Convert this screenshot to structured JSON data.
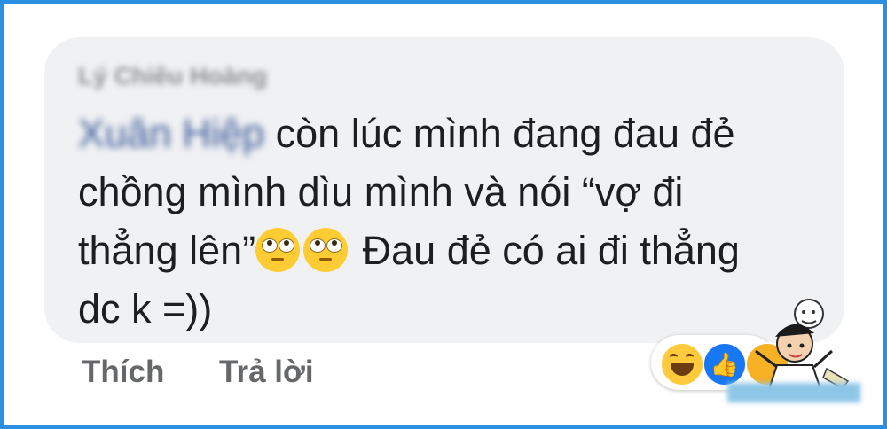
{
  "comment": {
    "author": "Lý Chiêu Hoàng",
    "mention": "Xuân Hiệp",
    "lines": [
      " còn lúc mình đang đau đẻ",
      "chồng mình dìu mình và nói “vợ đi",
      "thẳng lên”",
      " Đau đẻ có ai đi thẳng",
      "dc k =))"
    ],
    "emoji": [
      "rolling-eyes-emoji",
      "rolling-eyes-emoji"
    ]
  },
  "actions": {
    "like_label": "Thích",
    "reply_label": "Trả lời"
  },
  "reactions": [
    "haha-reaction-icon",
    "like-reaction-icon",
    "reaction-icon"
  ],
  "colors": {
    "frame": "#2a8fe0",
    "bubble": "#f0f1f3",
    "text": "#1c1e21",
    "action_text": "#65676b",
    "mention": "#385898",
    "like_blue": "#1877f2"
  }
}
